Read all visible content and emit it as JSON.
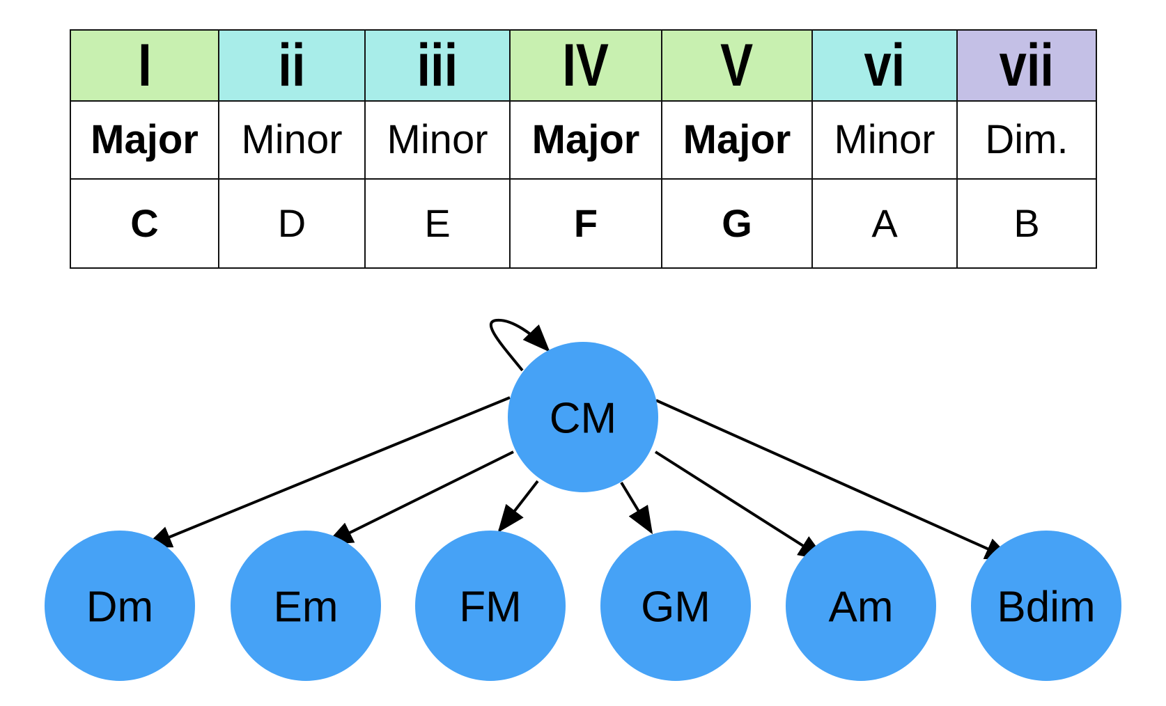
{
  "table": {
    "columns": [
      {
        "numeral": "I",
        "quality": "Major",
        "root": "C",
        "color": "#c8f0b0",
        "emphasis": true
      },
      {
        "numeral": "ii",
        "quality": "Minor",
        "root": "D",
        "color": "#a8ede9",
        "emphasis": false
      },
      {
        "numeral": "iii",
        "quality": "Minor",
        "root": "E",
        "color": "#a8ede9",
        "emphasis": false
      },
      {
        "numeral": "IV",
        "quality": "Major",
        "root": "F",
        "color": "#c8f0b0",
        "emphasis": true
      },
      {
        "numeral": "V",
        "quality": "Major",
        "root": "G",
        "color": "#c8f0b0",
        "emphasis": true
      },
      {
        "numeral": "vi",
        "quality": "Minor",
        "root": "A",
        "color": "#a8ede9",
        "emphasis": false
      },
      {
        "numeral": "vii",
        "quality": "Dim.",
        "root": "B",
        "color": "#c4c0e6",
        "emphasis": false
      }
    ]
  },
  "graph": {
    "node_color": "#46a2f6",
    "edge_color": "#000000",
    "root": {
      "id": "CM",
      "label": "CM"
    },
    "children": [
      {
        "id": "Dm",
        "label": "Dm"
      },
      {
        "id": "Em",
        "label": "Em"
      },
      {
        "id": "FM",
        "label": "FM"
      },
      {
        "id": "GM",
        "label": "GM"
      },
      {
        "id": "Am",
        "label": "Am"
      },
      {
        "id": "Bdim",
        "label": "Bdim"
      }
    ],
    "edges": [
      {
        "from": "CM",
        "to": "CM"
      },
      {
        "from": "CM",
        "to": "Dm"
      },
      {
        "from": "CM",
        "to": "Em"
      },
      {
        "from": "CM",
        "to": "FM"
      },
      {
        "from": "CM",
        "to": "GM"
      },
      {
        "from": "CM",
        "to": "Am"
      },
      {
        "from": "CM",
        "to": "Bdim"
      }
    ]
  }
}
